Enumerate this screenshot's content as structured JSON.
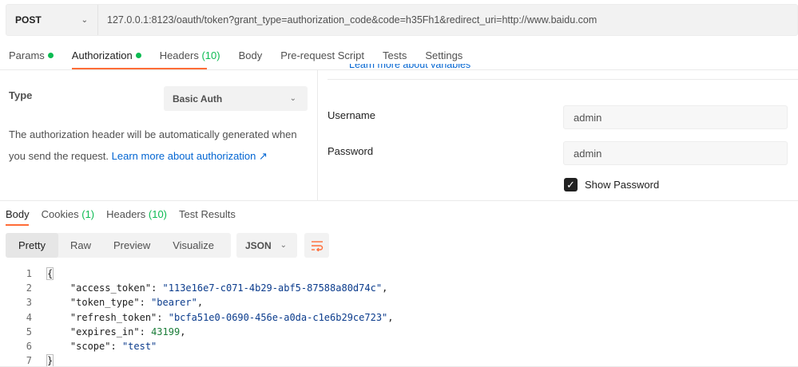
{
  "request": {
    "method": "POST",
    "url": "127.0.0.1:8123/oauth/token?grant_type=authorization_code&code=h35Fh1&redirect_uri=http://www.baidu.com"
  },
  "request_tabs": [
    {
      "label": "Params",
      "dot": true
    },
    {
      "label": "Authorization",
      "dot": true,
      "active": true
    },
    {
      "label": "Headers",
      "count": "(10)"
    },
    {
      "label": "Body"
    },
    {
      "label": "Pre-request Script"
    },
    {
      "label": "Tests"
    },
    {
      "label": "Settings"
    }
  ],
  "auth": {
    "type_label": "Type",
    "type_value": "Basic Auth",
    "description": "The authorization header will be automatically generated when you send the request.",
    "learn_more": "Learn more about authorization ↗",
    "cut_text": "Learn more about variables",
    "username_label": "Username",
    "username_value": "admin",
    "password_label": "Password",
    "password_value": "admin",
    "show_password_label": "Show Password",
    "show_password_checked": true
  },
  "response_tabs": [
    {
      "label": "Body",
      "active": true
    },
    {
      "label": "Cookies",
      "count": "(1)"
    },
    {
      "label": "Headers",
      "count": "(10)"
    },
    {
      "label": "Test Results"
    }
  ],
  "view_modes": [
    "Pretty",
    "Raw",
    "Preview",
    "Visualize"
  ],
  "active_view": "Pretty",
  "format": "JSON",
  "code_lines": [
    {
      "n": "1",
      "text": "{"
    },
    {
      "n": "2",
      "key": "\"access_token\"",
      "value": "\"113e16e7-c071-4b29-abf5-87588a80d74c\"",
      "kind": "s",
      "trail": ","
    },
    {
      "n": "3",
      "key": "\"token_type\"",
      "value": "\"bearer\"",
      "kind": "s",
      "trail": ","
    },
    {
      "n": "4",
      "key": "\"refresh_token\"",
      "value": "\"bcfa51e0-0690-456e-a0da-c1e6b29ce723\"",
      "kind": "s",
      "trail": ","
    },
    {
      "n": "5",
      "key": "\"expires_in\"",
      "value": "43199",
      "kind": "n",
      "trail": ","
    },
    {
      "n": "6",
      "key": "\"scope\"",
      "value": "\"test\"",
      "kind": "s",
      "trail": ""
    },
    {
      "n": "7",
      "text": "}"
    }
  ],
  "colors": {
    "accent": "#ff6c37",
    "status_dot": "#0cbb52",
    "link": "#0265d2"
  }
}
